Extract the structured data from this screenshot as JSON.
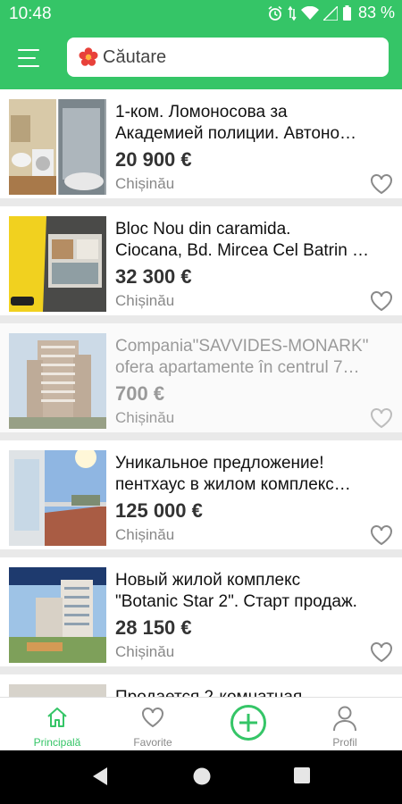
{
  "status_bar": {
    "time": "10:48",
    "battery": "83 %"
  },
  "search": {
    "placeholder": "Căutare"
  },
  "colors": {
    "brand": "#35c567",
    "price": "#333333",
    "muted": "#888888"
  },
  "listings": [
    {
      "title_line1": "1-ком. Ломоносова за",
      "title_line2": "Академией полиции. Автоно…",
      "price": "20 900 €",
      "city": "Chișinău",
      "faded": false
    },
    {
      "title_line1": "Bloc Nou din caramida.",
      "title_line2": "Ciocana, Bd. Mircea Cel Batrin …",
      "price": "32 300 €",
      "city": "Chișinău",
      "faded": false
    },
    {
      "title_line1": "Compania\"SAVVIDES-MONARK\"",
      "title_line2": "ofera apartamente în centrul 7…",
      "price": "700 €",
      "city": "Chișinău",
      "faded": true
    },
    {
      "title_line1": "Уникальное предложение!",
      "title_line2": "пентхаус в жилом комплекс…",
      "price": "125 000 €",
      "city": "Chișinău",
      "faded": false
    },
    {
      "title_line1": "Новый жилой комплекс",
      "title_line2": "\"Botanic Star 2\". Старт продаж.",
      "price": "28 150 €",
      "city": "Chișinău",
      "faded": false
    },
    {
      "title_line1": "Продается 2-комнатная",
      "title_line2": "",
      "price": "",
      "city": "",
      "faded": false
    }
  ],
  "bottom_nav": {
    "home": "Principală",
    "favorites": "Favorite",
    "add": "",
    "profile": "Profil"
  }
}
